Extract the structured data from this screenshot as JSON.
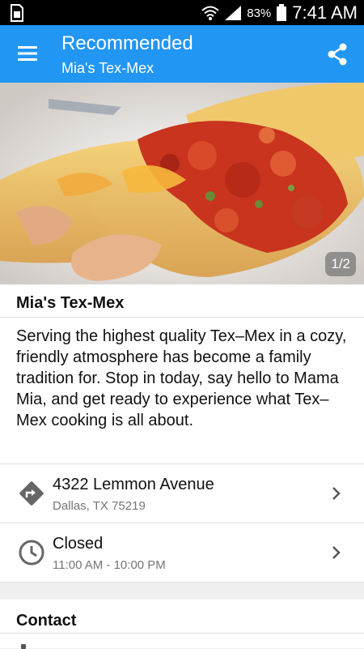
{
  "status_bar": {
    "battery_percent": "83%",
    "time": "7:41 AM"
  },
  "app_bar": {
    "title": "Recommended",
    "subtitle": "Mia's Tex-Mex"
  },
  "hero": {
    "counter": "1/2"
  },
  "business": {
    "name": "Mia's Tex-Mex",
    "description": "Serving the highest quality Tex–Mex in a cozy, friendly atmosphere has become a family tradition for. Stop in today, say hello to Mama Mia, and get ready to experience what Tex–Mex cooking is all about."
  },
  "address": {
    "line1": "4322 Lemmon Avenue",
    "line2": "Dallas, TX 75219"
  },
  "hours": {
    "status": "Closed",
    "range": "11:00 AM - 10:00 PM"
  },
  "contact": {
    "heading": "Contact"
  },
  "colors": {
    "accent": "#2196f3",
    "icon_gray": "#666666"
  }
}
